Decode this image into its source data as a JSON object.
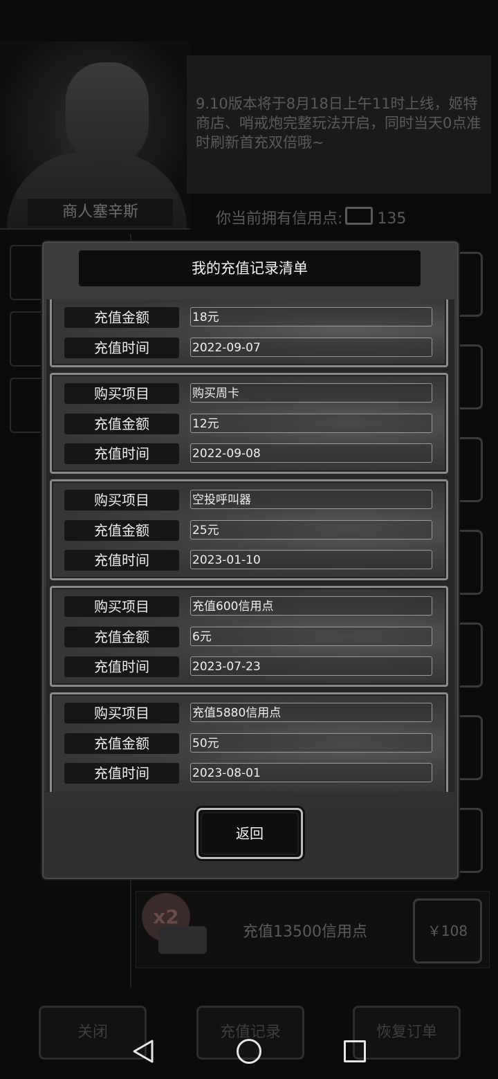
{
  "background": {
    "merchant_name": "商人塞辛斯",
    "notice": "9.10版本将于8月18日上午11时上线，姬特商店、哨戒炮完整玩法开启，同时当天0点准时刷新首充双倍哦~",
    "credits_label": "你当前拥有信用点:",
    "credits_value": "135",
    "featured_item": {
      "badge": "x2",
      "label": "充值13500信用点",
      "price": "￥108"
    },
    "buttons": {
      "close": "关闭",
      "records": "充值记录",
      "restore": "恢复订单"
    }
  },
  "modal": {
    "title": "我的充值记录清单",
    "back_label": "返回",
    "records": [
      {
        "rows": [
          {
            "label": "充值金额",
            "value": "18元"
          },
          {
            "label": "充值时间",
            "value": "2022-09-07"
          }
        ]
      },
      {
        "rows": [
          {
            "label": "购买项目",
            "value": "购买周卡"
          },
          {
            "label": "充值金额",
            "value": "12元"
          },
          {
            "label": "充值时间",
            "value": "2022-09-08"
          }
        ]
      },
      {
        "rows": [
          {
            "label": "购买项目",
            "value": "空投呼叫器"
          },
          {
            "label": "充值金额",
            "value": "25元"
          },
          {
            "label": "充值时间",
            "value": "2023-01-10"
          }
        ]
      },
      {
        "rows": [
          {
            "label": "购买项目",
            "value": "充值600信用点"
          },
          {
            "label": "充值金额",
            "value": "6元"
          },
          {
            "label": "充值时间",
            "value": "2023-07-23"
          }
        ]
      },
      {
        "rows": [
          {
            "label": "购买项目",
            "value": "充值5880信用点"
          },
          {
            "label": "充值金额",
            "value": "50元"
          },
          {
            "label": "充值时间",
            "value": "2023-08-01"
          }
        ]
      }
    ]
  },
  "navbar": {
    "icons": [
      "back-triangle",
      "home-circle",
      "recents-square"
    ]
  }
}
